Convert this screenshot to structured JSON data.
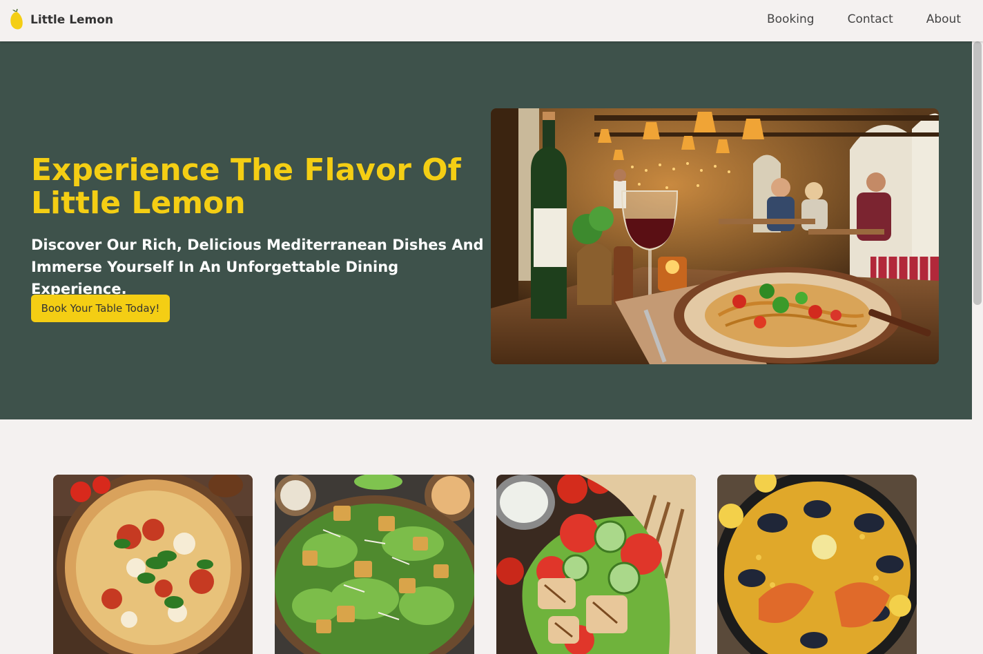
{
  "header": {
    "brand": "Little Lemon",
    "logo_icon": "lemon-icon",
    "nav": [
      {
        "label": "Booking"
      },
      {
        "label": "Contact"
      },
      {
        "label": "About"
      }
    ]
  },
  "hero": {
    "title": "Experience The Flavor Of Little Lemon",
    "subtitle": "Discover Our Rich, Delicious Mediterranean Dishes And Immerse Yourself In An Unforgettable Dining Experience.",
    "cta_label": "Book Your Table Today!",
    "image": "restaurant-interior-photo"
  },
  "dishes": [
    {
      "image": "margherita-pizza-photo"
    },
    {
      "image": "caesar-salad-photo"
    },
    {
      "image": "chicken-wrap-photo"
    },
    {
      "image": "seafood-paella-photo"
    }
  ],
  "colors": {
    "primary_green": "#3e524b",
    "accent_yellow": "#f4ce14",
    "background": "#f4f1f0"
  }
}
